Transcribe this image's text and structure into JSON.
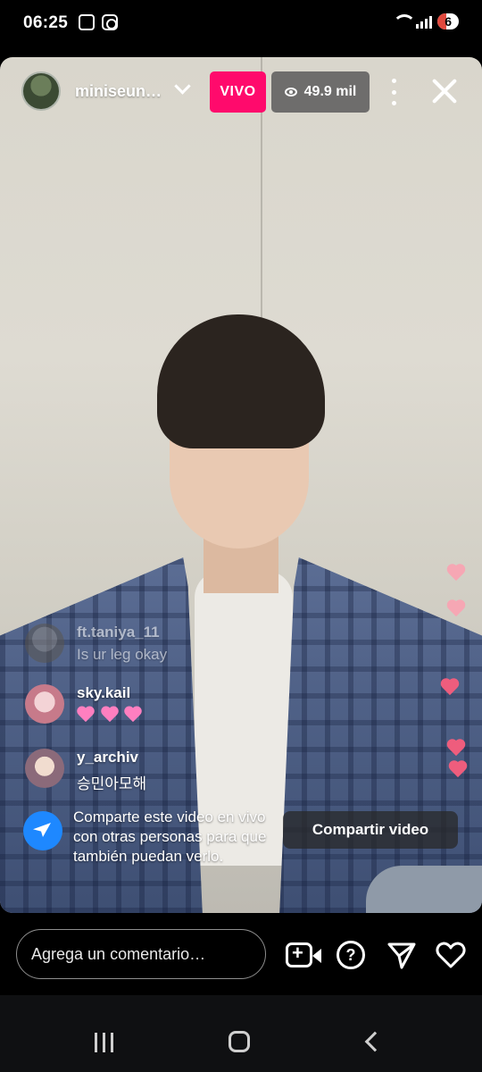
{
  "status_bar": {
    "time": "06:25",
    "battery_level": "6",
    "icons": [
      "scan-icon",
      "instagram-icon",
      "wifi-icon",
      "signal-icon",
      "battery-icon"
    ]
  },
  "live": {
    "host_username": "miniseun…",
    "live_badge": "VIVO",
    "viewer_count": "49.9 mil"
  },
  "comments": [
    {
      "username": "ft.taniya_11",
      "text": "Is ur leg okay"
    },
    {
      "username": "sky.kail",
      "text": "",
      "hearts": 3
    },
    {
      "username": "y_archiv",
      "text": "승민아모해"
    }
  ],
  "share_prompt": {
    "message": "Comparte este video en vivo con otras personas para que también puedan verlo.",
    "button_label": "Compartir video"
  },
  "comment_bar": {
    "placeholder": "Agrega un comentario…"
  },
  "colors": {
    "live_badge": "#ff0a6c",
    "share_icon": "#1e88ff",
    "reaction_hearts": "#ee5d7d"
  }
}
